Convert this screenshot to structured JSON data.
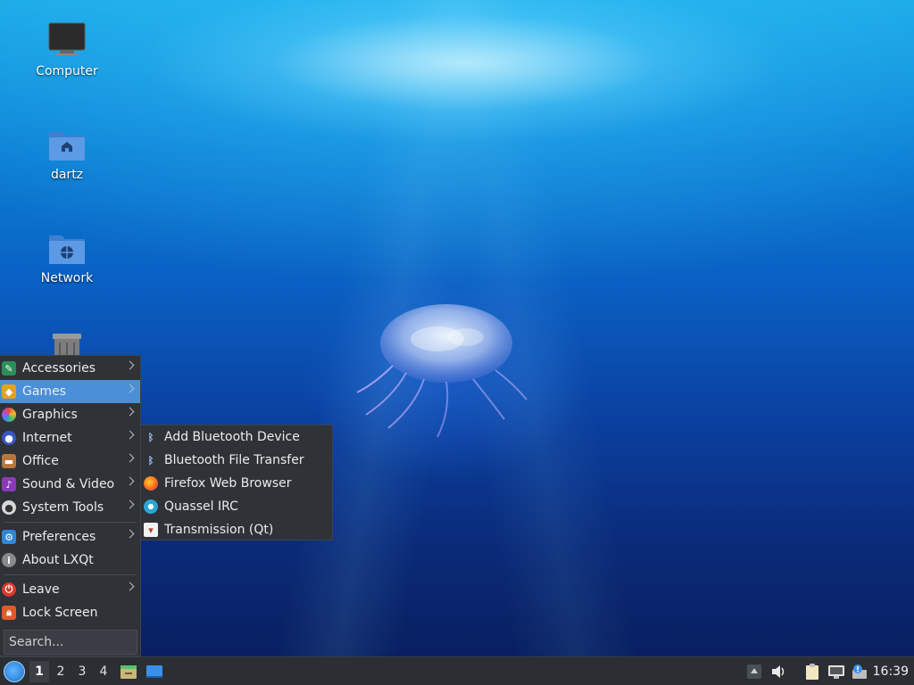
{
  "desktop": {
    "icons": [
      {
        "label": "Computer",
        "icon": "monitor-icon"
      },
      {
        "label": "dartz",
        "icon": "home-folder-icon"
      },
      {
        "label": "Network",
        "icon": "network-folder-icon"
      },
      {
        "label": "",
        "icon": "trash-icon"
      }
    ]
  },
  "main_menu": {
    "items": [
      {
        "label": "Accessories",
        "icon": "accessories-icon",
        "submenu": true
      },
      {
        "label": "Games",
        "icon": "games-icon",
        "submenu": true,
        "active": true
      },
      {
        "label": "Graphics",
        "icon": "graphics-icon",
        "submenu": true
      },
      {
        "label": "Internet",
        "icon": "internet-icon",
        "submenu": true
      },
      {
        "label": "Office",
        "icon": "office-icon",
        "submenu": true
      },
      {
        "label": "Sound & Video",
        "icon": "sound-video-icon",
        "submenu": true
      },
      {
        "label": "System Tools",
        "icon": "system-tools-icon",
        "submenu": true
      },
      {
        "label": "Preferences",
        "icon": "preferences-icon",
        "submenu": true
      },
      {
        "label": "About LXQt",
        "icon": "info-icon",
        "submenu": false
      },
      {
        "label": "Leave",
        "icon": "power-icon",
        "submenu": true
      },
      {
        "label": "Lock Screen",
        "icon": "lock-icon",
        "submenu": false
      }
    ],
    "search_placeholder": "Search..."
  },
  "submenu": {
    "items": [
      {
        "label": "Add Bluetooth Device",
        "icon": "bluetooth-icon"
      },
      {
        "label": "Bluetooth File Transfer",
        "icon": "bluetooth-icon"
      },
      {
        "label": "Firefox Web Browser",
        "icon": "firefox-icon"
      },
      {
        "label": "Quassel IRC",
        "icon": "quassel-icon"
      },
      {
        "label": "Transmission (Qt)",
        "icon": "transmission-icon"
      }
    ]
  },
  "taskbar": {
    "workspaces": [
      "1",
      "2",
      "3",
      "4"
    ],
    "active_workspace": "1",
    "clock": "16:39"
  },
  "colors": {
    "menu_bg": "#2f3237",
    "highlight": "#4a90d9",
    "taskbar_bg": "#2b2e33"
  }
}
